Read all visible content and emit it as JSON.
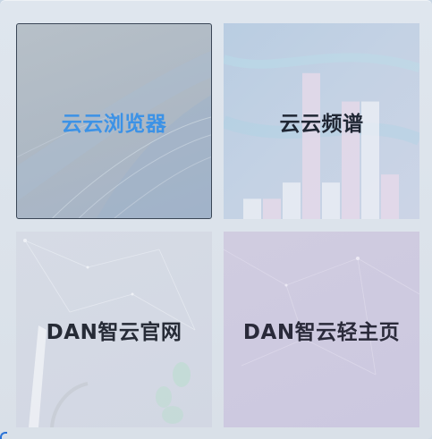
{
  "tiles": [
    {
      "label": "云云浏览器"
    },
    {
      "label": "云云频谱"
    },
    {
      "label": "DAN智云官网"
    },
    {
      "label": "DAN智云轻主页"
    }
  ],
  "chart_data": {
    "type": "bar",
    "values": [
      10,
      10,
      18,
      72,
      18,
      58,
      58,
      22
    ]
  }
}
